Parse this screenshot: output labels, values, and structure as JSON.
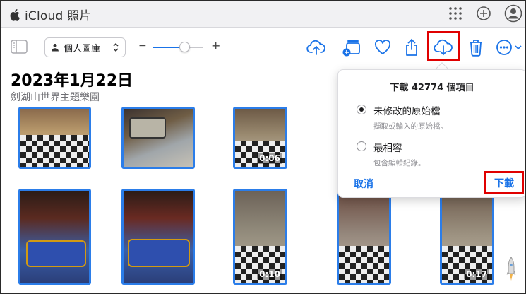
{
  "app": {
    "title": "iCloud 照片"
  },
  "toolbar": {
    "library_label": "個人圖庫",
    "zoom_minus": "−",
    "zoom_plus": "+",
    "zoom_level": 0.55
  },
  "album": {
    "date": "2023年1月22日",
    "location": "劍湖山世界主題樂園"
  },
  "grid": {
    "row1": [
      {
        "duration": ""
      },
      {
        "duration": ""
      },
      {
        "duration": "0:06"
      }
    ],
    "row2": [
      {
        "duration": ""
      },
      {
        "duration": ""
      },
      {
        "duration": "0:10"
      },
      {
        "duration": ""
      },
      {
        "duration": "0:17"
      }
    ]
  },
  "download_popover": {
    "title": "下載 42774 個項目",
    "options": [
      {
        "label": "未修改的原始檔",
        "description": "擷取或輸入的原始檔。",
        "selected": true
      },
      {
        "label": "最相容",
        "description": "包含編輯紀錄。",
        "selected": false
      }
    ],
    "cancel_label": "取消",
    "download_label": "下載"
  },
  "colors": {
    "accent": "#1a73e8",
    "highlight": "#e00000",
    "selection_border": "#2b7de9"
  }
}
